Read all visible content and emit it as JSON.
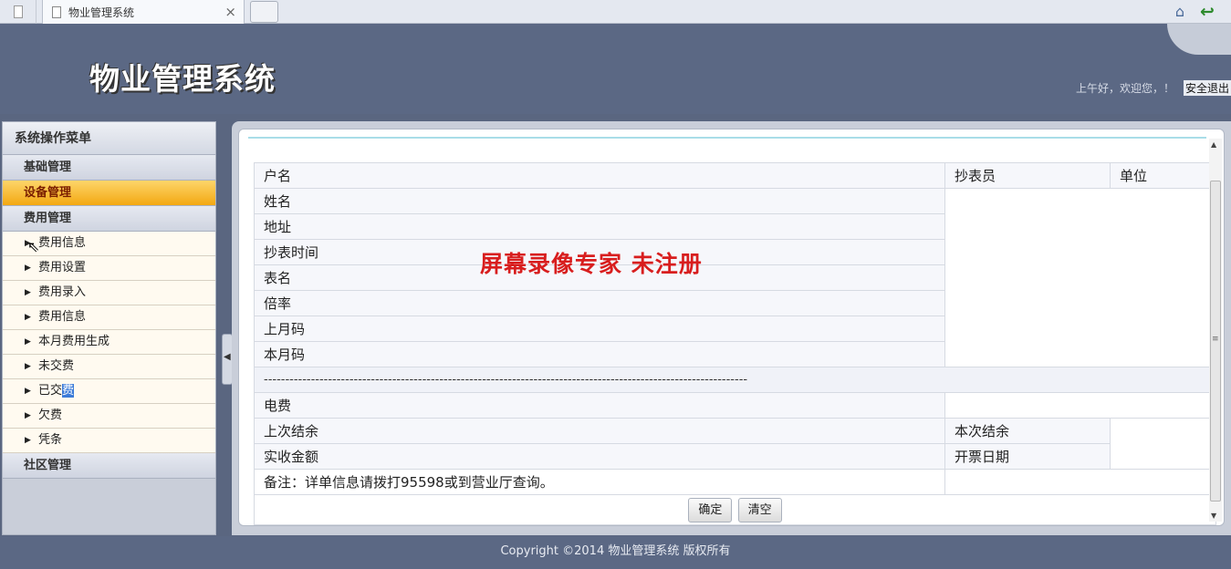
{
  "browser": {
    "tab_title": "物业管理系统",
    "close_glyph": "×"
  },
  "header": {
    "logo": "物业管理系统",
    "greeting": "上午好，欢迎您，！",
    "logout": "安全退出"
  },
  "sidebar": {
    "title": "系统操作菜单",
    "groups": [
      "基础管理",
      "设备管理",
      "费用管理",
      "社区管理"
    ],
    "active_group": "设备管理",
    "subitems": [
      "费用信息",
      "费用设置",
      "费用录入",
      "费用信息",
      "本月费用生成",
      "未交费",
      "已交费",
      "欠费",
      "凭条"
    ]
  },
  "form": {
    "labels": {
      "account": "户名",
      "reader": "抄表员",
      "unit": "单位",
      "name": "姓名",
      "address": "地址",
      "read_time": "抄表时间",
      "meter": "表名",
      "ratio": "倍率",
      "last_reading": "上月码",
      "this_reading": "本月码",
      "separator": "-----------------------------------------------------------------------------------------------------------------",
      "electric_fee": "电费",
      "last_balance": "上次结余",
      "this_balance": "本次结余",
      "paid_amount": "实收金额",
      "invoice_date": "开票日期",
      "note": "备注：详单信息请拨打95598或到营业厅查询。"
    },
    "buttons": {
      "confirm": "确定",
      "clear": "清空"
    }
  },
  "watermark": "屏幕录像专家  未注册",
  "footer": "Copyright ©2014 物业管理系统 版权所有"
}
